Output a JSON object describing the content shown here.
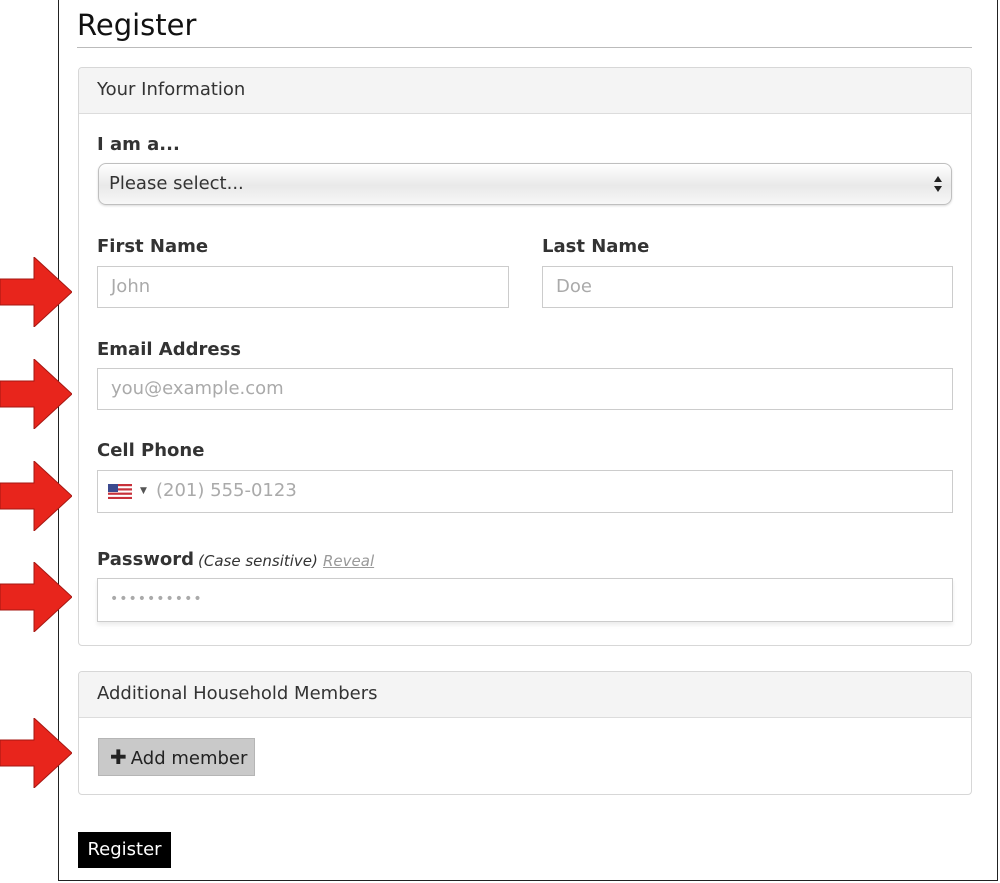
{
  "page": {
    "title": "Register"
  },
  "your_info": {
    "heading": "Your Information",
    "role": {
      "label": "I am a...",
      "selected": "Please select..."
    },
    "first_name": {
      "label": "First Name",
      "placeholder": "John"
    },
    "last_name": {
      "label": "Last Name",
      "placeholder": "Doe"
    },
    "email": {
      "label": "Email Address",
      "placeholder": "you@example.com"
    },
    "cell_phone": {
      "label": "Cell Phone",
      "country_icon": "us-flag-icon",
      "placeholder": "(201) 555-0123"
    },
    "password": {
      "label": "Password",
      "note": "(Case sensitive)",
      "reveal": "Reveal",
      "placeholder": "••••••••••"
    }
  },
  "household": {
    "heading": "Additional Household Members",
    "add_button": {
      "icon": "plus-icon",
      "label": "Add member"
    }
  },
  "submit": {
    "label": "Register"
  },
  "annotations": {
    "arrow_color": "#e8251c",
    "arrow_icon": "right-arrow-icon"
  }
}
